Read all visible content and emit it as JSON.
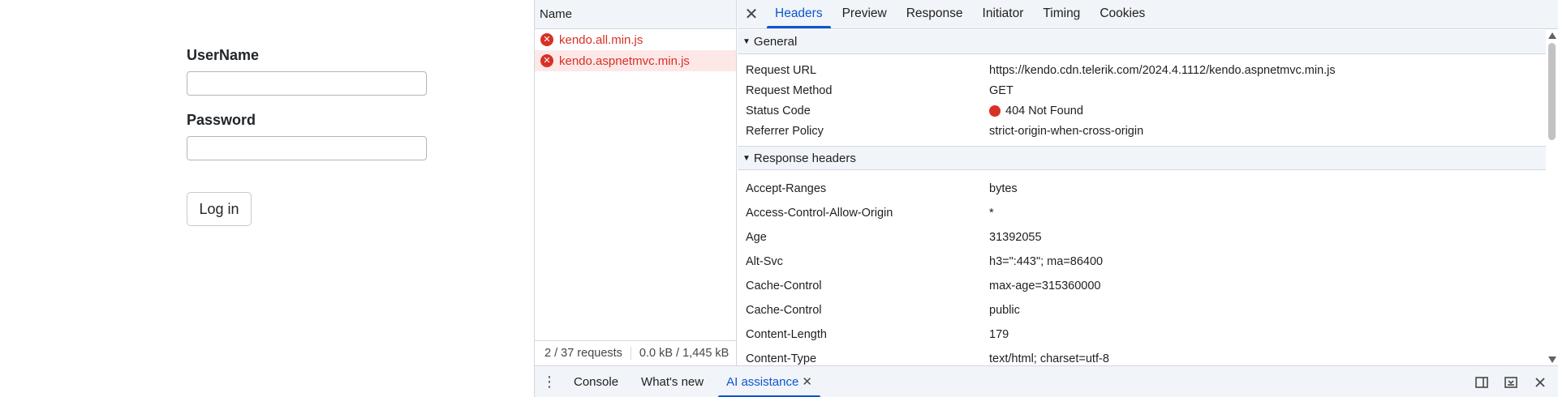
{
  "login": {
    "username_label": "UserName",
    "username_value": "",
    "password_label": "Password",
    "password_value": "",
    "login_button": "Log in"
  },
  "network": {
    "list_header": "Name",
    "requests": [
      {
        "name": "kendo.all.min.js",
        "status": "error",
        "selected": false
      },
      {
        "name": "kendo.aspnetmvc.min.js",
        "status": "error",
        "selected": true
      }
    ],
    "footer_requests": "2 / 37 requests",
    "footer_size": "0.0 kB / 1,445 kB"
  },
  "detail": {
    "close_glyph": "✕",
    "tabs": [
      {
        "label": "Headers",
        "active": true
      },
      {
        "label": "Preview",
        "active": false
      },
      {
        "label": "Response",
        "active": false
      },
      {
        "label": "Initiator",
        "active": false
      },
      {
        "label": "Timing",
        "active": false
      },
      {
        "label": "Cookies",
        "active": false
      }
    ],
    "general": {
      "title": "General",
      "rows": [
        {
          "key": "Request URL",
          "value": "https://kendo.cdn.telerik.com/2024.4.1112/kendo.aspnetmvc.min.js"
        },
        {
          "key": "Request Method",
          "value": "GET"
        },
        {
          "key": "Status Code",
          "value": "404 Not Found"
        },
        {
          "key": "Referrer Policy",
          "value": "strict-origin-when-cross-origin"
        }
      ]
    },
    "response_headers": {
      "title": "Response headers",
      "rows": [
        {
          "key": "Accept-Ranges",
          "value": "bytes"
        },
        {
          "key": "Access-Control-Allow-Origin",
          "value": "*"
        },
        {
          "key": "Age",
          "value": "31392055"
        },
        {
          "key": "Alt-Svc",
          "value": "h3=\":443\"; ma=86400"
        },
        {
          "key": "Cache-Control",
          "value": "max-age=315360000"
        },
        {
          "key": "Cache-Control",
          "value": "public"
        },
        {
          "key": "Content-Length",
          "value": "179"
        },
        {
          "key": "Content-Type",
          "value": "text/html; charset=utf-8"
        }
      ]
    }
  },
  "drawer": {
    "tabs": [
      {
        "label": "Console",
        "active": false,
        "closable": false
      },
      {
        "label": "What's new",
        "active": false,
        "closable": false
      },
      {
        "label": "AI assistance",
        "active": true,
        "closable": true
      }
    ]
  },
  "colors": {
    "accent": "#0b57d0",
    "error": "#d93025",
    "panel_bg": "#f1f4f9",
    "border": "#d2d7de"
  }
}
